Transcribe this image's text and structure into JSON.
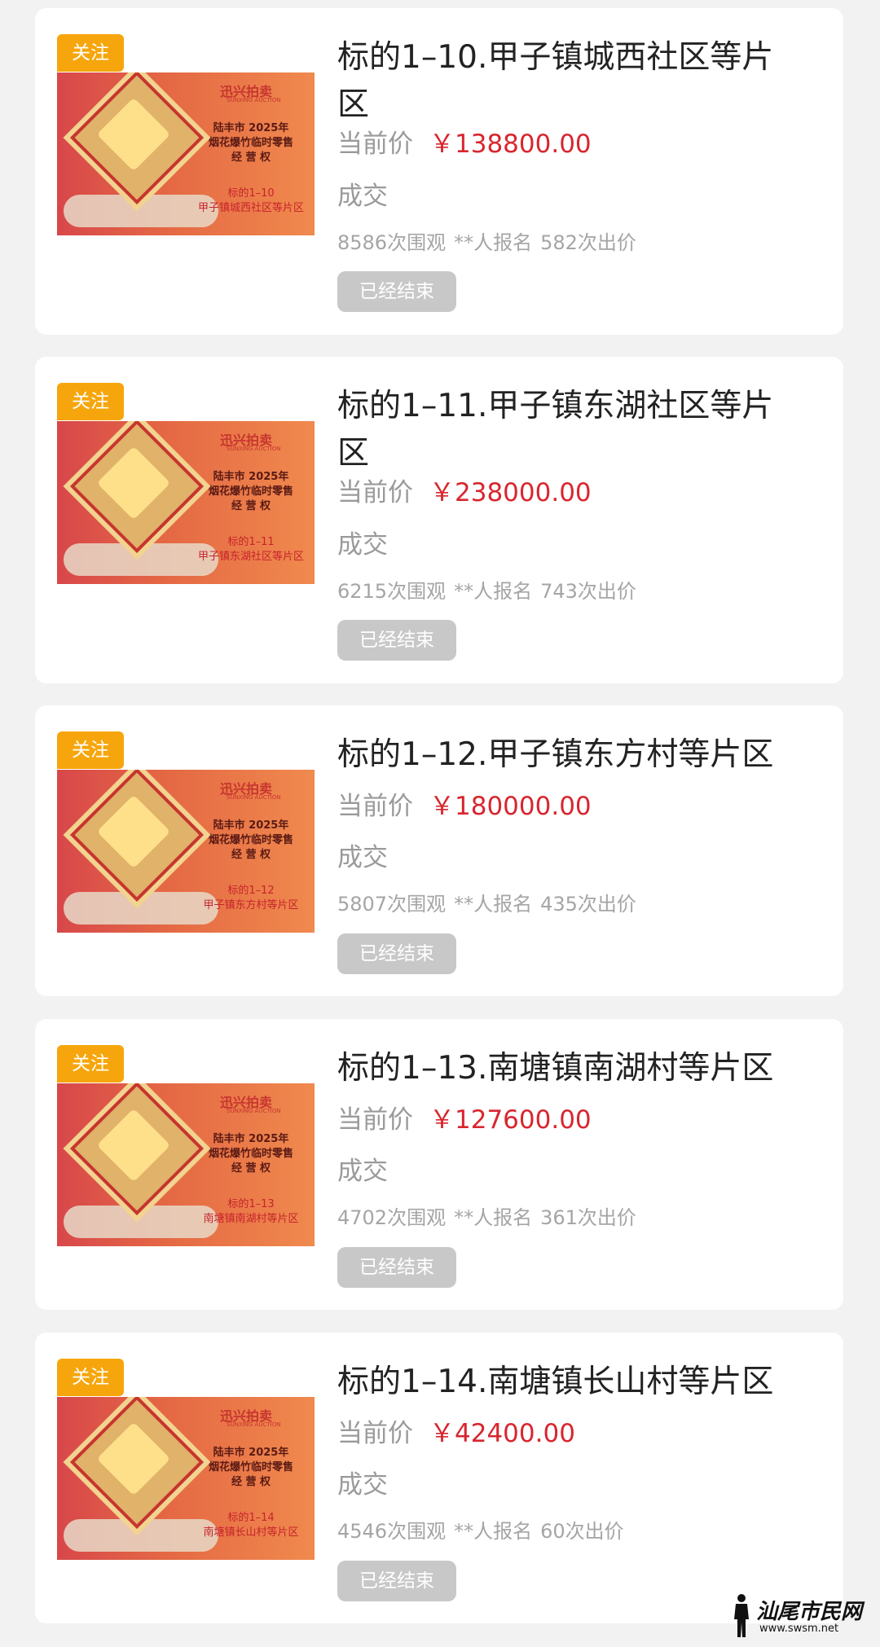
{
  "common": {
    "follow_label": "关注",
    "price_label": "当前价",
    "status_text": "成交",
    "registrants_text": "**人报名",
    "ended_label": "已经结束",
    "poster_logo": "迅兴拍卖",
    "poster_logo_sub": "SUNXING AUCTION",
    "poster_line1": "陆丰市 2025年",
    "poster_line2": "烟花爆竹临时零售",
    "poster_line3": "经 营 权"
  },
  "items": [
    {
      "title": "标的1–10.甲子镇城西社区等片区",
      "price": "￥138800.00",
      "views": "8586次围观",
      "bids": "582次出价",
      "poster_lot": "标的1–10",
      "poster_area": "甲子镇城西社区等片区"
    },
    {
      "title": "标的1–11.甲子镇东湖社区等片区",
      "price": "￥238000.00",
      "views": "6215次围观",
      "bids": "743次出价",
      "poster_lot": "标的1–11",
      "poster_area": "甲子镇东湖社区等片区"
    },
    {
      "title": "标的1–12.甲子镇东方村等片区",
      "price": "￥180000.00",
      "views": "5807次围观",
      "bids": "435次出价",
      "poster_lot": "标的1–12",
      "poster_area": "甲子镇东方村等片区"
    },
    {
      "title": "标的1–13.南塘镇南湖村等片区",
      "price": "￥127600.00",
      "views": "4702次围观",
      "bids": "361次出价",
      "poster_lot": "标的1–13",
      "poster_area": "南塘镇南湖村等片区"
    },
    {
      "title": "标的1–14.南塘镇长山村等片区",
      "price": "￥42400.00",
      "views": "4546次围观",
      "bids": "60次出价",
      "poster_lot": "标的1–14",
      "poster_area": "南塘镇长山村等片区"
    }
  ],
  "watermark": {
    "text": "汕尾市民网",
    "url": "www.swsm.net"
  }
}
